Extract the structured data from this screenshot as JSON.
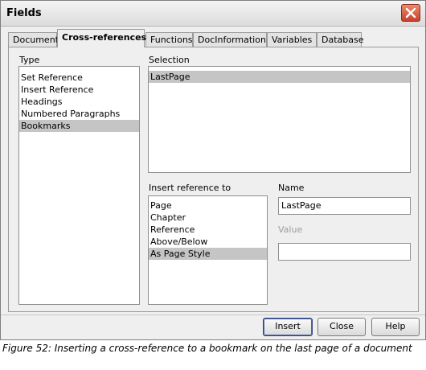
{
  "dialog": {
    "title": "Fields",
    "close_icon": "close-icon"
  },
  "tabs": [
    {
      "label": "Document"
    },
    {
      "label": "Cross-references",
      "active": true
    },
    {
      "label": "Functions"
    },
    {
      "label": "DocInformation"
    },
    {
      "label": "Variables"
    },
    {
      "label": "Database"
    }
  ],
  "type": {
    "label": "Type",
    "items": [
      "Set Reference",
      "Insert Reference",
      "Headings",
      "Numbered Paragraphs",
      "Bookmarks"
    ],
    "selected": "Bookmarks"
  },
  "selection": {
    "label": "Selection",
    "items": [
      "LastPage"
    ],
    "selected": "LastPage"
  },
  "insert_reference_to": {
    "label": "Insert reference to",
    "items": [
      "Page",
      "Chapter",
      "Reference",
      "Above/Below",
      "As Page Style"
    ],
    "selected": "As Page Style"
  },
  "name": {
    "label": "Name",
    "value": "LastPage"
  },
  "value": {
    "label": "Value",
    "value": ""
  },
  "buttons": {
    "insert": "Insert",
    "close": "Close",
    "help": "Help"
  },
  "caption": "Figure 52: Inserting a cross-reference to a bookmark on the last page of a document"
}
